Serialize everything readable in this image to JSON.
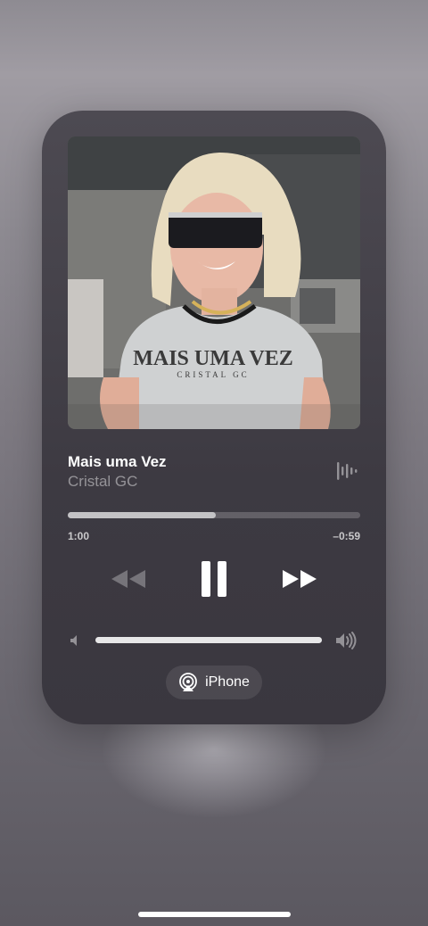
{
  "now_playing": {
    "title": "Mais uma Vez",
    "artist": "Cristal GC",
    "artwork_shirt_text": "MAIS UMA VEZ",
    "artwork_shirt_subtext": "CRISTAL GC",
    "progress": {
      "elapsed": "1:00",
      "remaining": "–0:59",
      "fraction": 0.505
    },
    "volume": {
      "fraction": 1.0
    },
    "output_route": {
      "label": "iPhone",
      "icon": "airplay-icon"
    }
  },
  "controls": {
    "rewind_icon": "rewind-icon",
    "pause_icon": "pause-icon",
    "forward_icon": "fast-forward-icon",
    "waveform_icon": "waveform-icon",
    "volume_low_icon": "speaker-low-icon",
    "volume_high_icon": "speaker-high-icon"
  },
  "colors": {
    "player_background": "#444149",
    "text_primary": "#ffffff",
    "text_secondary": "rgba(255,255,255,0.45)"
  }
}
